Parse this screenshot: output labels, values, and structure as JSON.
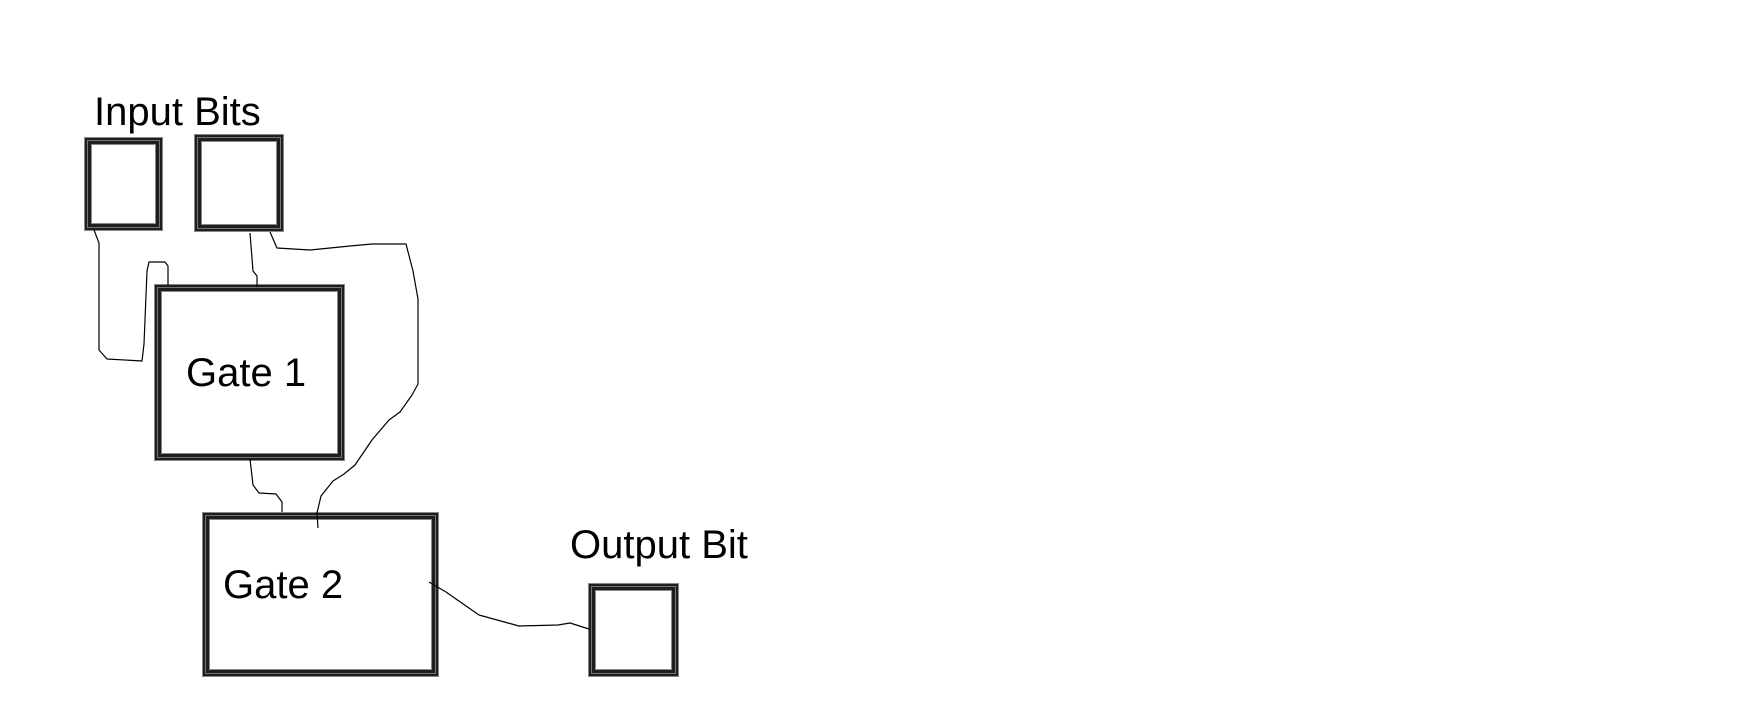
{
  "labels": {
    "input_bits": "Input Bits",
    "gate1": "Gate 1",
    "gate2": "Gate 2",
    "output_bit": "Output Bit"
  },
  "nodes": [
    {
      "id": "input-bit-1",
      "kind": "input"
    },
    {
      "id": "input-bit-2",
      "kind": "input"
    },
    {
      "id": "gate-1",
      "kind": "gate",
      "label": "Gate 1"
    },
    {
      "id": "gate-2",
      "kind": "gate",
      "label": "Gate 2"
    },
    {
      "id": "output-bit",
      "kind": "output"
    }
  ],
  "edges": [
    {
      "from": "input-bit-1",
      "to": "gate-1"
    },
    {
      "from": "input-bit-2",
      "to": "gate-1"
    },
    {
      "from": "input-bit-2",
      "to": "gate-2"
    },
    {
      "from": "gate-1",
      "to": "gate-2"
    },
    {
      "from": "gate-2",
      "to": "output-bit"
    }
  ]
}
